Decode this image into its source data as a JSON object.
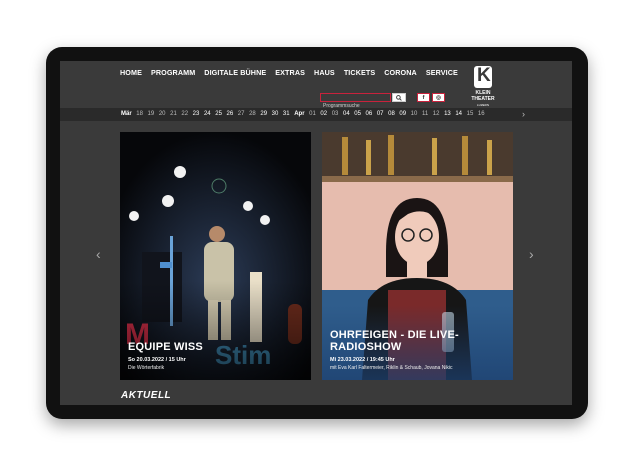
{
  "nav": {
    "items": [
      "HOME",
      "PROGRAMM",
      "DIGITALE BÜHNE",
      "EXTRAS",
      "HAUS",
      "TICKETS",
      "CORONA",
      "SERVICE"
    ]
  },
  "search": {
    "placeholder": "Programmsuche"
  },
  "social": {
    "facebook": "f",
    "instagram": "◎"
  },
  "logo": {
    "line1": "KLEIN",
    "line2": "THEATER",
    "line3": "LUZERN"
  },
  "dates": {
    "items": [
      {
        "label": "Mär",
        "month": true
      },
      {
        "label": "18"
      },
      {
        "label": "19"
      },
      {
        "label": "20"
      },
      {
        "label": "21"
      },
      {
        "label": "22"
      },
      {
        "label": "23",
        "active": true
      },
      {
        "label": "24",
        "active": true
      },
      {
        "label": "25",
        "active": true
      },
      {
        "label": "26",
        "active": true
      },
      {
        "label": "27"
      },
      {
        "label": "28"
      },
      {
        "label": "29",
        "active": true
      },
      {
        "label": "30",
        "active": true
      },
      {
        "label": "31",
        "active": true
      },
      {
        "label": "Apr",
        "month": true
      },
      {
        "label": "01"
      },
      {
        "label": "02",
        "active": true
      },
      {
        "label": "03"
      },
      {
        "label": "04",
        "active": true
      },
      {
        "label": "05",
        "active": true
      },
      {
        "label": "06",
        "active": true
      },
      {
        "label": "07",
        "active": true
      },
      {
        "label": "08",
        "active": true
      },
      {
        "label": "09",
        "active": true
      },
      {
        "label": "10"
      },
      {
        "label": "11"
      },
      {
        "label": "12"
      },
      {
        "label": "13",
        "active": true
      },
      {
        "label": "14",
        "active": true
      },
      {
        "label": "15"
      },
      {
        "label": "16"
      }
    ]
  },
  "events": [
    {
      "title": "EQUIPE WISS",
      "date": "So 20.03.2022 / 15 Uhr",
      "subtitle": "Die Wörterfabrik"
    },
    {
      "title_line1": "OHRFEIGEN - DIE LIVE-",
      "title_line2": "RADIOSHOW",
      "date": "Mi 23.03.2022 / 19:45 Uhr",
      "subtitle": "mit Eva Karl Faltermeier, Riklin & Schaub, Jovana Nikic"
    }
  ],
  "section": {
    "aktuell": "AKTUELL"
  },
  "colors": {
    "accent": "#c8223c",
    "background": "#3a3a3a",
    "strip": "#2a2a2a"
  }
}
